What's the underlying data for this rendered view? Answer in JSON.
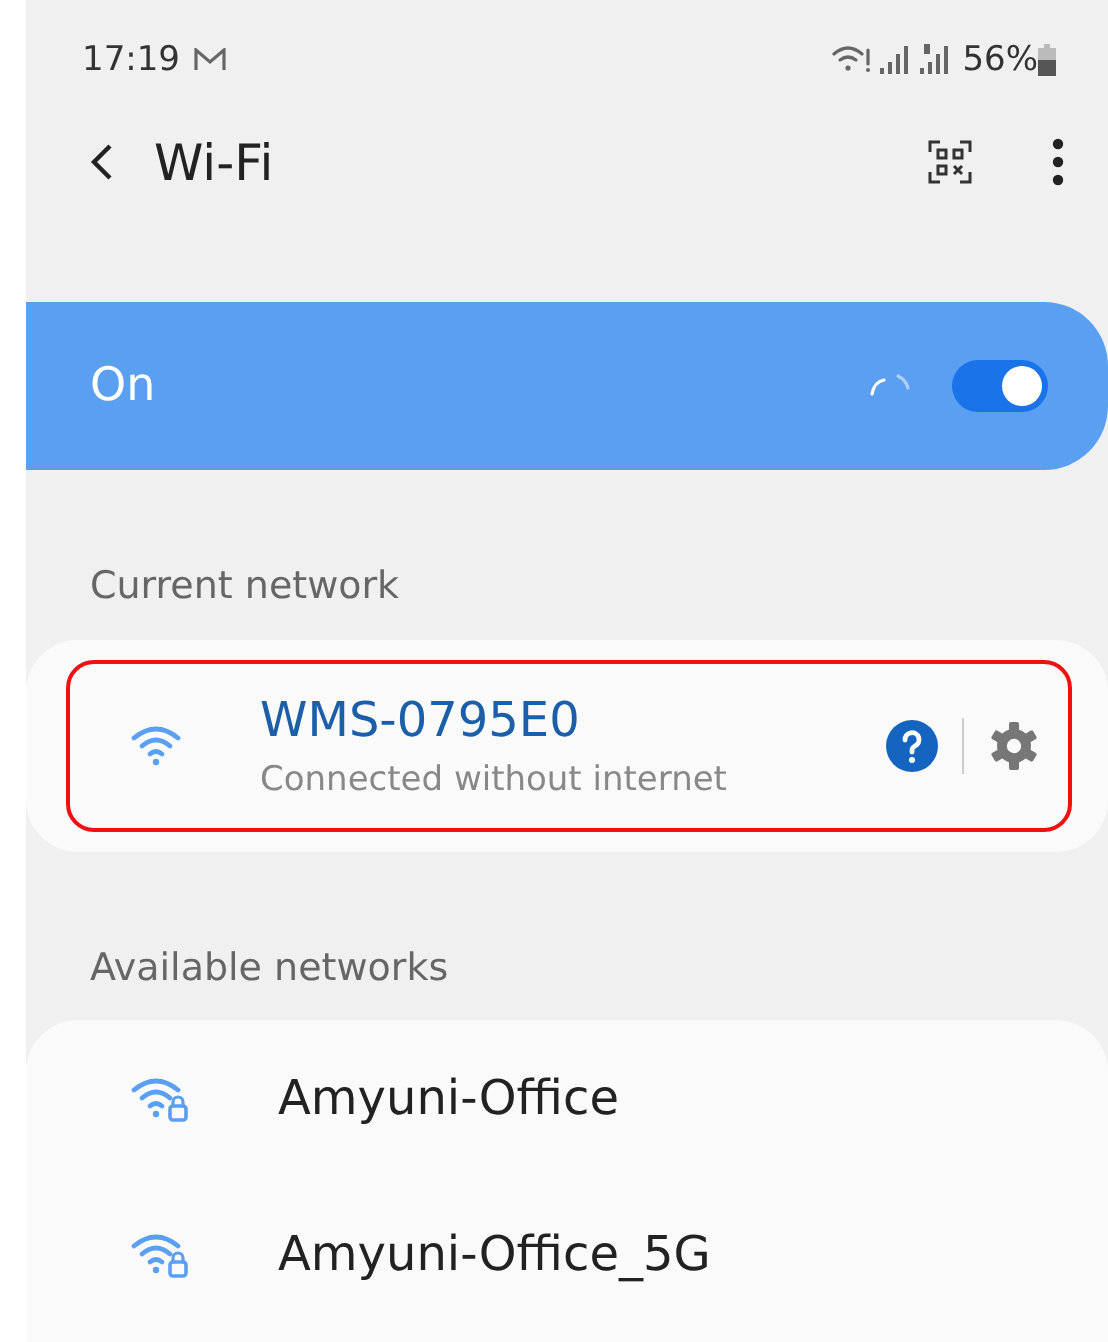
{
  "status_bar": {
    "time": "17:19",
    "battery": "56%"
  },
  "title": "Wi-Fi",
  "wifi_switch": {
    "label": "On",
    "on": true
  },
  "current_network": {
    "heading": "Current network",
    "name": "WMS-0795E0",
    "status": "Connected without internet",
    "highlighted": true
  },
  "available_networks": {
    "heading": "Available networks",
    "networks": [
      {
        "name": "Amyuni-Office",
        "secured": true
      },
      {
        "name": "Amyuni-Office_5G",
        "secured": true
      }
    ]
  }
}
